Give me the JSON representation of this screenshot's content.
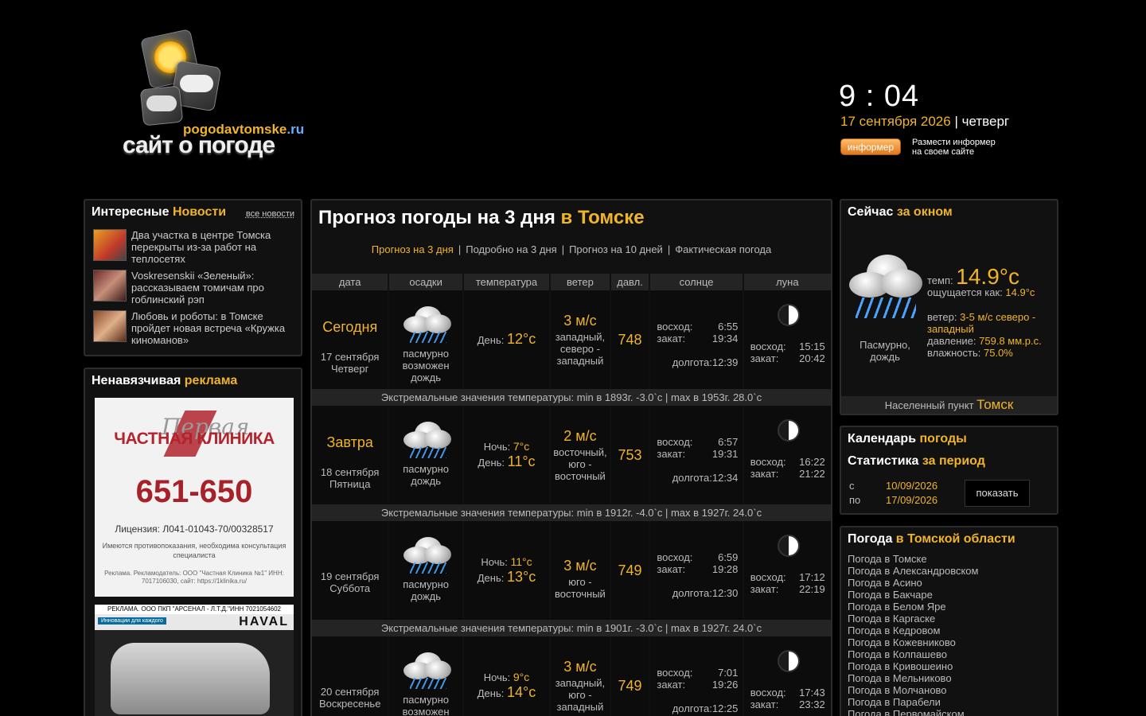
{
  "header": {
    "logo_site": "pogodavtomske",
    "logo_tld": ".ru",
    "logo_title": "сайт о погоде",
    "clock_h": "9",
    "clock_m": "04",
    "date": "17 сентября 2026",
    "weekday": "четверг",
    "informer_button": "информер",
    "informer_text_1": "Размести информер",
    "informer_text_2": "на своем сайте"
  },
  "news": {
    "title_a": "Интересные",
    "title_b": "Новости",
    "all_link": "все новости",
    "items": [
      {
        "text": "Два участка в центре Томска перекрыты из-за работ на теплосетях"
      },
      {
        "text": "Voskresenskii «Зеленый»: рассказываем томичам про гоблинский рэп"
      },
      {
        "text": "Любовь и роботы: в Томске пройдет новая встреча «Кружка киноманов»"
      }
    ]
  },
  "ads": {
    "title_a": "Ненавязчивая",
    "title_b": "реклама",
    "ad1_script": "Первая",
    "ad1_brand": "ЧАСТНАЯ КЛИНИКА",
    "ad1_phone": "651-650",
    "ad1_license": "Лицензия: Л041-01043-70/00328517",
    "ad1_note": "Имеются противопоказания, необходима консультация специалиста",
    "ad1_rek": "Реклама. Рекламодатель: ООО \"Частная Клиника №1\" ИНН: 7017106030, сайт: https://1klinika.ru/",
    "ad2_rek": "РЕКЛАМА. ООО ПКП \"АРСЕНАЛ - Л.Т.Д.\"ИНН 7021054602",
    "ad2_slogan": "Инновации для каждого",
    "ad2_brand": "HAVAL"
  },
  "main": {
    "title_a": "Прогноз погоды на 3 дня",
    "title_b": "в Томске",
    "tabs": [
      {
        "label": "Прогноз на 3 дня",
        "active": true
      },
      {
        "label": "Подробно на 3 дня"
      },
      {
        "label": "Прогноз на 10 дней"
      },
      {
        "label": "Фактическая погода"
      }
    ],
    "columns": [
      "дата",
      "осадки",
      "температура",
      "ветер",
      "давл.",
      "солнце",
      "луна"
    ],
    "labels": {
      "night": "Ночь:",
      "day": "День:",
      "sunrise": "восход:",
      "sunset": "закат:",
      "daylength": "долгота:",
      "moonrise": "восход:",
      "moonset": "закат:"
    },
    "days": [
      {
        "dayname": "Сегодня",
        "date": "17 сентября",
        "weekday": "Четверг",
        "precip": "пасмурно возможен дождь",
        "night": "",
        "day": "12°c",
        "wind_speed": "3 м/с",
        "wind_dir": "западный, северо - западный",
        "pressure": "748",
        "sunrise": "6:55",
        "sunset": "19:34",
        "daylength": "12:39",
        "moonrise": "15:15",
        "moonset": "20:42",
        "extreme": "Экстремальные значения температуры: min в 1893г. -3.0`c | max в 1953г. 28.0`c"
      },
      {
        "dayname": "Завтра",
        "date": "18 сентября",
        "weekday": "Пятница",
        "precip": "пасмурно дождь",
        "night": "7°c",
        "day": "11°c",
        "wind_speed": "2 м/с",
        "wind_dir": "восточный, юго - восточный",
        "pressure": "753",
        "sunrise": "6:57",
        "sunset": "19:31",
        "daylength": "12:34",
        "moonrise": "16:22",
        "moonset": "21:22",
        "extreme": "Экстремальные значения температуры: min в 1912г. -4.0`c | max в 1927г. 24.0`c"
      },
      {
        "dayname": "",
        "date": "19 сентября",
        "weekday": "Суббота",
        "precip": "пасмурно дождь",
        "night": "11°c",
        "day": "13°c",
        "wind_speed": "3 м/с",
        "wind_dir": "юго - восточный",
        "pressure": "749",
        "sunrise": "6:59",
        "sunset": "19:28",
        "daylength": "12:30",
        "moonrise": "17:12",
        "moonset": "22:19",
        "extreme": "Экстремальные значения температуры: min в 1901г. -3.0`c | max в 1927г. 24.0`c"
      },
      {
        "dayname": "",
        "date": "20 сентября",
        "weekday": "Воскресенье",
        "precip": "пасмурно возможен дождь",
        "night": "9°c",
        "day": "14°c",
        "wind_speed": "3 м/с",
        "wind_dir": "западный, юго - западный",
        "pressure": "749",
        "sunrise": "7:01",
        "sunset": "19:26",
        "daylength": "12:25",
        "moonrise": "17:43",
        "moonset": "23:32",
        "extreme": ""
      }
    ]
  },
  "now": {
    "title_a": "Сейчас",
    "title_b": "за окном",
    "condition": "Пасмурно, дождь",
    "temp_label": "темп:",
    "temp": "14.9°c",
    "feels_label": "ощущается как:",
    "feels": "14.9°c",
    "wind_label": "ветер:",
    "wind": "3-5 м/с северо - западный",
    "pressure_label": "давление:",
    "pressure": "759.8 мм.р.с.",
    "humidity_label": "влажность:",
    "humidity": "75.0%",
    "place_label": "Населенный пункт",
    "place": "Томск"
  },
  "calendar": {
    "title_a": "Календарь",
    "title_b": "погоды",
    "stat_a": "Статистика",
    "stat_b": "за период",
    "from_label": "с",
    "from": "10/09/2026",
    "to_label": "по",
    "to": "17/09/2026",
    "show_button": "показать"
  },
  "region": {
    "title_a": "Погода",
    "title_b": "в Томской области",
    "items": [
      "Погода в Томске",
      "Погода в Александровском",
      "Погода в Асино",
      "Погода в Бакчаре",
      "Погода в Белом Яре",
      "Погода в Каргаске",
      "Погода в Кедровом",
      "Погода в Кожевниково",
      "Погода в Колпашево",
      "Погода в Кривошеино",
      "Погода в Мельниково",
      "Погода в Молчаново",
      "Погода в Парабели",
      "Погода в Первомайском"
    ]
  },
  "colors": {
    "accent": "#f0b429",
    "background": "#000000",
    "panel": "#111111"
  },
  "icons": {
    "logo": "weather-logo-icon",
    "precip": "rain-cloud-icon",
    "moon": "moon-phase-icon"
  }
}
